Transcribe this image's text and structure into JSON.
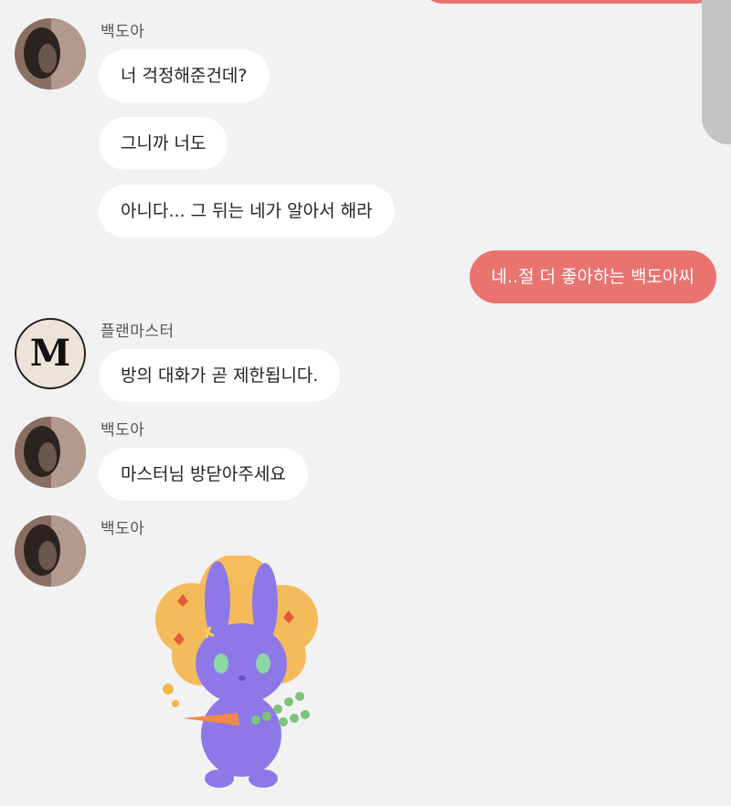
{
  "colors": {
    "background": "#f2f2f2",
    "my_bubble": "#e8736f",
    "other_bubble": "#ffffff",
    "scrollbar": "#c4c4c4"
  },
  "messages": {
    "group1": {
      "sender": "백도아",
      "lines": [
        "너 걱정해준건데?",
        "그니까 너도",
        "아니다... 그 뒤는 네가 알아서 해라"
      ]
    },
    "mine1": "네..절 더 좋아하는 백도아씨",
    "group2": {
      "sender": "플랜마스터",
      "avatar_letter": "M",
      "lines": [
        "방의 대화가 곧 제한됩니다."
      ]
    },
    "group3": {
      "sender": "백도아",
      "lines": [
        "마스터님 방닫아주세요"
      ]
    },
    "group4": {
      "sender": "백도아",
      "sticker": "purple-rabbit-with-carrot-sticker"
    }
  }
}
